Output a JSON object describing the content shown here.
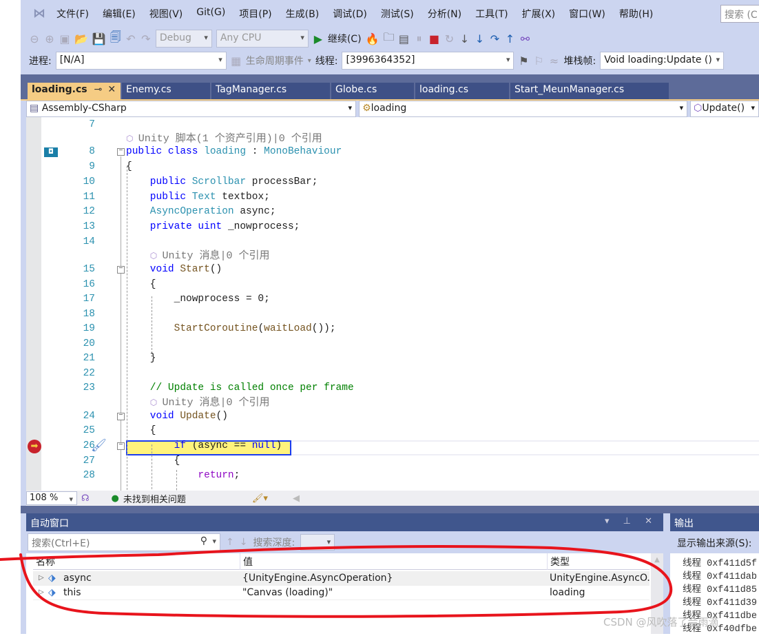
{
  "menu": [
    "文件(F)",
    "编辑(E)",
    "视图(V)",
    "Git(G)",
    "项目(P)",
    "生成(B)",
    "调试(D)",
    "测试(S)",
    "分析(N)",
    "工具(T)",
    "扩展(X)",
    "窗口(W)",
    "帮助(H)"
  ],
  "search_placeholder": "搜索 (C",
  "toolbar": {
    "config": "Debug",
    "platform": "Any CPU",
    "continue_label": "继续(C)"
  },
  "debug_location": {
    "process_label": "进程:",
    "process_value": "[N/A]",
    "lifecycle_label": "生命周期事件",
    "thread_label": "线程:",
    "thread_value": "[3996364352]",
    "stack_label": "堆栈帧:",
    "stack_value": "Void loading:Update ()"
  },
  "tabs": [
    {
      "label": "loading.cs",
      "active": true
    },
    {
      "label": "Enemy.cs"
    },
    {
      "label": "TagManager.cs"
    },
    {
      "label": "Globe.cs"
    },
    {
      "label": "loading.cs"
    },
    {
      "label": "Start_MeunManager.cs"
    }
  ],
  "navbar": {
    "project": "Assembly-CSharp",
    "type": "loading",
    "member": "Update()"
  },
  "code_lines": [
    {
      "num": "7",
      "tokens": []
    },
    {
      "num": "",
      "anno": "Unity 脚本(1 个资产引用)|0 个引用",
      "indent": 0
    },
    {
      "num": "8",
      "tokens": [
        [
          "public ",
          "kw"
        ],
        [
          "class ",
          "kw"
        ],
        [
          "loading",
          "ty"
        ],
        [
          " : ",
          "pl"
        ],
        [
          "MonoBehaviour",
          "ty"
        ]
      ]
    },
    {
      "num": "9",
      "tokens": [
        [
          "{",
          "pl"
        ]
      ]
    },
    {
      "num": "10",
      "tokens": [
        [
          "    public ",
          "kw"
        ],
        [
          "Scrollbar ",
          "ty"
        ],
        [
          "processBar;",
          "pl"
        ]
      ]
    },
    {
      "num": "11",
      "tokens": [
        [
          "    public ",
          "kw"
        ],
        [
          "Text ",
          "ty"
        ],
        [
          "textbox;",
          "pl"
        ]
      ]
    },
    {
      "num": "12",
      "tokens": [
        [
          "    AsyncOperation ",
          "ty"
        ],
        [
          "async;",
          "pl"
        ]
      ]
    },
    {
      "num": "13",
      "tokens": [
        [
          "    private ",
          "kw"
        ],
        [
          "uint ",
          "kw"
        ],
        [
          "_nowprocess;",
          "pl"
        ]
      ]
    },
    {
      "num": "14",
      "tokens": []
    },
    {
      "num": "",
      "anno": "Unity 消息|0 个引用",
      "indent": 4
    },
    {
      "num": "15",
      "tokens": [
        [
          "    void ",
          "kw"
        ],
        [
          "Start",
          "fn"
        ],
        [
          "()",
          "pl"
        ]
      ]
    },
    {
      "num": "16",
      "tokens": [
        [
          "    {",
          "pl"
        ]
      ]
    },
    {
      "num": "17",
      "tokens": [
        [
          "        _nowprocess = 0;",
          "pl"
        ]
      ]
    },
    {
      "num": "18",
      "tokens": []
    },
    {
      "num": "19",
      "tokens": [
        [
          "        StartCoroutine",
          "fn"
        ],
        [
          "(",
          "pl"
        ],
        [
          "waitLoad",
          "fn"
        ],
        [
          "());",
          "pl"
        ]
      ]
    },
    {
      "num": "20",
      "tokens": []
    },
    {
      "num": "21",
      "tokens": [
        [
          "    }",
          "pl"
        ]
      ]
    },
    {
      "num": "22",
      "tokens": []
    },
    {
      "num": "23",
      "tokens": [
        [
          "    // Update is called once per frame",
          "cm"
        ]
      ]
    },
    {
      "num": "",
      "anno": "Unity 消息|0 个引用",
      "indent": 4
    },
    {
      "num": "24",
      "tokens": [
        [
          "    void ",
          "kw"
        ],
        [
          "Update",
          "fn"
        ],
        [
          "()",
          "pl"
        ]
      ]
    },
    {
      "num": "25",
      "tokens": [
        [
          "    {",
          "pl"
        ]
      ]
    },
    {
      "num": "26",
      "tokens": [
        [
          "        if ",
          "kw"
        ],
        [
          "(async == ",
          "pl"
        ],
        [
          "null",
          "kw"
        ],
        [
          ")",
          "pl"
        ]
      ]
    },
    {
      "num": "27",
      "tokens": [
        [
          "        {",
          "pl"
        ]
      ]
    },
    {
      "num": "28",
      "tokens": [
        [
          "            return",
          "ret"
        ],
        [
          ";",
          "pl"
        ]
      ]
    }
  ],
  "statusbar": {
    "zoom": "108 %",
    "issues": "未找到相关问题"
  },
  "auto_window": {
    "title": "自动窗口",
    "search_placeholder": "搜索(Ctrl+E)",
    "depth_label": "搜索深度:",
    "columns": [
      "名称",
      "值",
      "类型"
    ],
    "rows": [
      {
        "name": "async",
        "value": "{UnityEngine.AsyncOperation}",
        "type": "UnityEngine.AsyncO..."
      },
      {
        "name": "this",
        "value": "\"Canvas (loading)\"",
        "type": "loading"
      }
    ]
  },
  "output": {
    "title": "输出",
    "source_label": "显示输出来源(S):",
    "lines": [
      "线程 0xf411d5f",
      "线程 0xf411dab",
      "线程 0xf411d85",
      "线程 0xf411d39",
      "线程 0xf411dbe",
      "线程 0xf40dfbe"
    ]
  },
  "watermark": "CSDN @风吹落了会雨滴",
  "annotation_color": "#e8141c"
}
